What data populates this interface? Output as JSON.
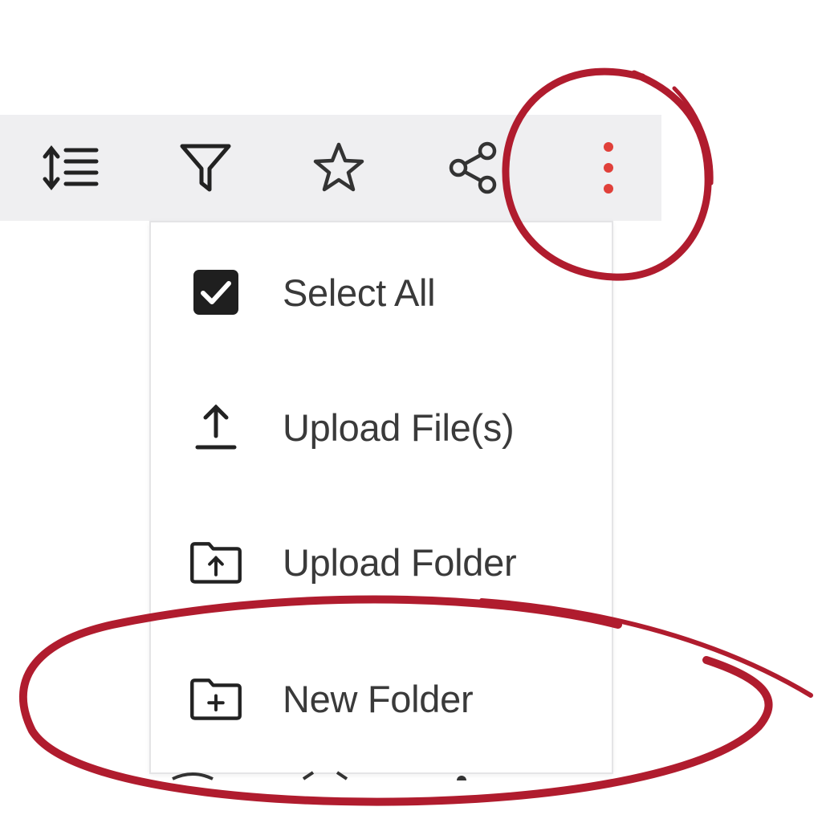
{
  "toolbar": {
    "buttons": [
      {
        "name": "sort-button",
        "icon": "sort-icon"
      },
      {
        "name": "filter-button",
        "icon": "filter-icon"
      },
      {
        "name": "favorite-button",
        "icon": "star-icon"
      },
      {
        "name": "share-button",
        "icon": "share-icon"
      },
      {
        "name": "more-options-button",
        "icon": "vertical-dots-icon",
        "color": "#e0403a"
      }
    ]
  },
  "menu": {
    "items": [
      {
        "label": "Select All",
        "icon": "checkbox-checked-icon"
      },
      {
        "label": "Upload File(s)",
        "icon": "upload-icon"
      },
      {
        "label": "Upload Folder",
        "icon": "folder-upload-icon"
      },
      {
        "label": "New Folder",
        "icon": "folder-add-icon"
      }
    ]
  },
  "annotation": {
    "color": "#b01c2e",
    "marks": [
      "more-options-button",
      "New Folder"
    ]
  },
  "colors": {
    "toolbar_bg": "#efeff1",
    "icon": "#333333",
    "text": "#3a3a3a"
  }
}
